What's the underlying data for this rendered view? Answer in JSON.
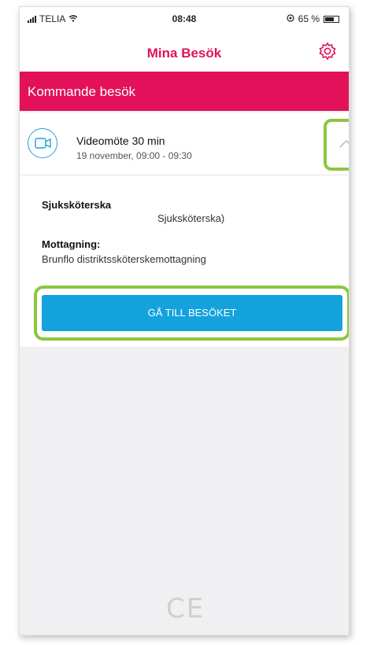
{
  "status_bar": {
    "carrier": "TELIA",
    "time": "08:48",
    "battery": "65 %"
  },
  "header": {
    "title": "Mina Besök",
    "settings_icon": "gear-icon"
  },
  "section": {
    "title": "Kommande besök"
  },
  "appointment": {
    "icon": "video-camera-icon",
    "title": "Videomöte 30 min",
    "datetime": "19 november, 09:00 - 09:30",
    "expand_icon": "chevron-up-icon"
  },
  "details": {
    "role_label": "Sjuksköterska",
    "role_value": "Sjuksköterska)",
    "clinic_label": "Mottagning:",
    "clinic_value": "Brunflo distriktssköterskemottagning"
  },
  "actions": {
    "go_to_visit": "GÅ TILL BESÖKET"
  },
  "footer": {
    "ce_mark": "CE"
  },
  "colors": {
    "brand": "#e2115a",
    "accent": "#14a2dd",
    "highlight": "#8dc63f"
  }
}
